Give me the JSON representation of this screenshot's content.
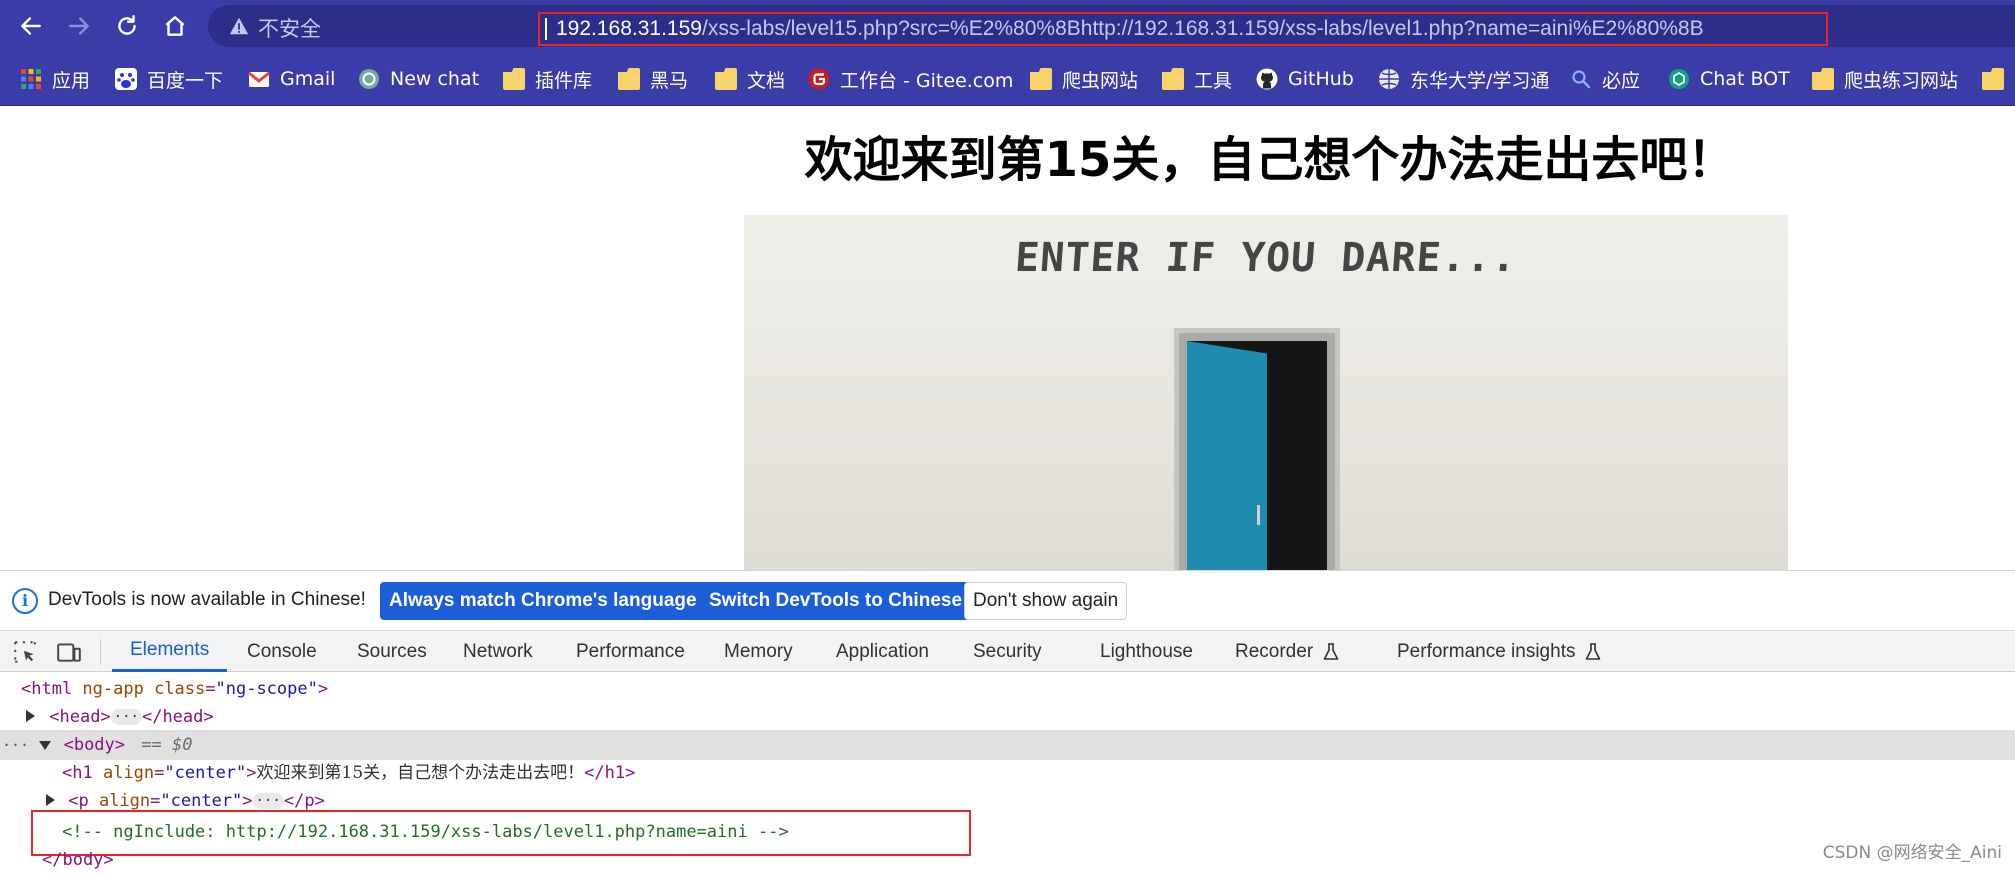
{
  "browser": {
    "insecure_label": "不安全",
    "url_host": "192.168.31.159",
    "url_path": "/xss-labs/level15.php?src=%E2%80%8Bhttp://192.168.31.159/xss-labs/level1.php?name=aini%E2%80%8B",
    "bookmarks": [
      {
        "label": "应用",
        "icon": "apps-grid-icon"
      },
      {
        "label": "百度一下",
        "icon": "baidu-paw-icon"
      },
      {
        "label": "Gmail",
        "icon": "gmail-icon"
      },
      {
        "label": "New chat",
        "icon": "openai-icon"
      },
      {
        "label": "插件库",
        "icon": "folder-icon"
      },
      {
        "label": "黑马",
        "icon": "folder-icon"
      },
      {
        "label": "文档",
        "icon": "folder-icon"
      },
      {
        "label": "工作台 - Gitee.com",
        "icon": "gitee-icon"
      },
      {
        "label": "爬虫网站",
        "icon": "folder-icon"
      },
      {
        "label": "工具",
        "icon": "folder-icon"
      },
      {
        "label": "GitHub",
        "icon": "github-icon"
      },
      {
        "label": "东华大学/学习通",
        "icon": "globe-icon"
      },
      {
        "label": "必应",
        "icon": "bing-search-icon"
      },
      {
        "label": "Chat BOT",
        "icon": "chatbot-icon"
      },
      {
        "label": "爬虫练习网站",
        "icon": "folder-icon"
      }
    ]
  },
  "page": {
    "title": "欢迎来到第15关，自己想个办法走出去吧！",
    "image_sign": "ENTER IF YOU DARE..."
  },
  "devtools": {
    "info_message": "DevTools is now available in Chinese!",
    "btn_match": "Always match Chrome's language",
    "btn_switch": "Switch DevTools to Chinese",
    "btn_dismiss": "Don't show again",
    "tabs": [
      "Elements",
      "Console",
      "Sources",
      "Network",
      "Performance",
      "Memory",
      "Application",
      "Security",
      "Lighthouse",
      "Recorder",
      "Performance insights"
    ],
    "dom": {
      "html_tag": "<html",
      "html_attr_name": " ng-app class",
      "html_attr_value": "\"ng-scope\"",
      "html_close": ">",
      "head_open": "<head>",
      "head_close": "</head>",
      "body_tag": "<body>",
      "body_marker": "== $0",
      "h1_open": "<h1",
      "h1_attr_name": " align",
      "h1_attr_value": "\"center\"",
      "h1_text": "欢迎来到第15关，自己想个办法走出去吧！",
      "h1_close": "</h1>",
      "p_open": "<p",
      "p_attr_name": " align",
      "p_attr_value": "\"center\"",
      "p_close": "</p>",
      "comment": "<!-- ngInclude: http://192.168.31.159/xss-labs/level1.php?name=aini -->",
      "body_close": "</body>"
    }
  },
  "watermark": "CSDN @网络安全_Aini"
}
